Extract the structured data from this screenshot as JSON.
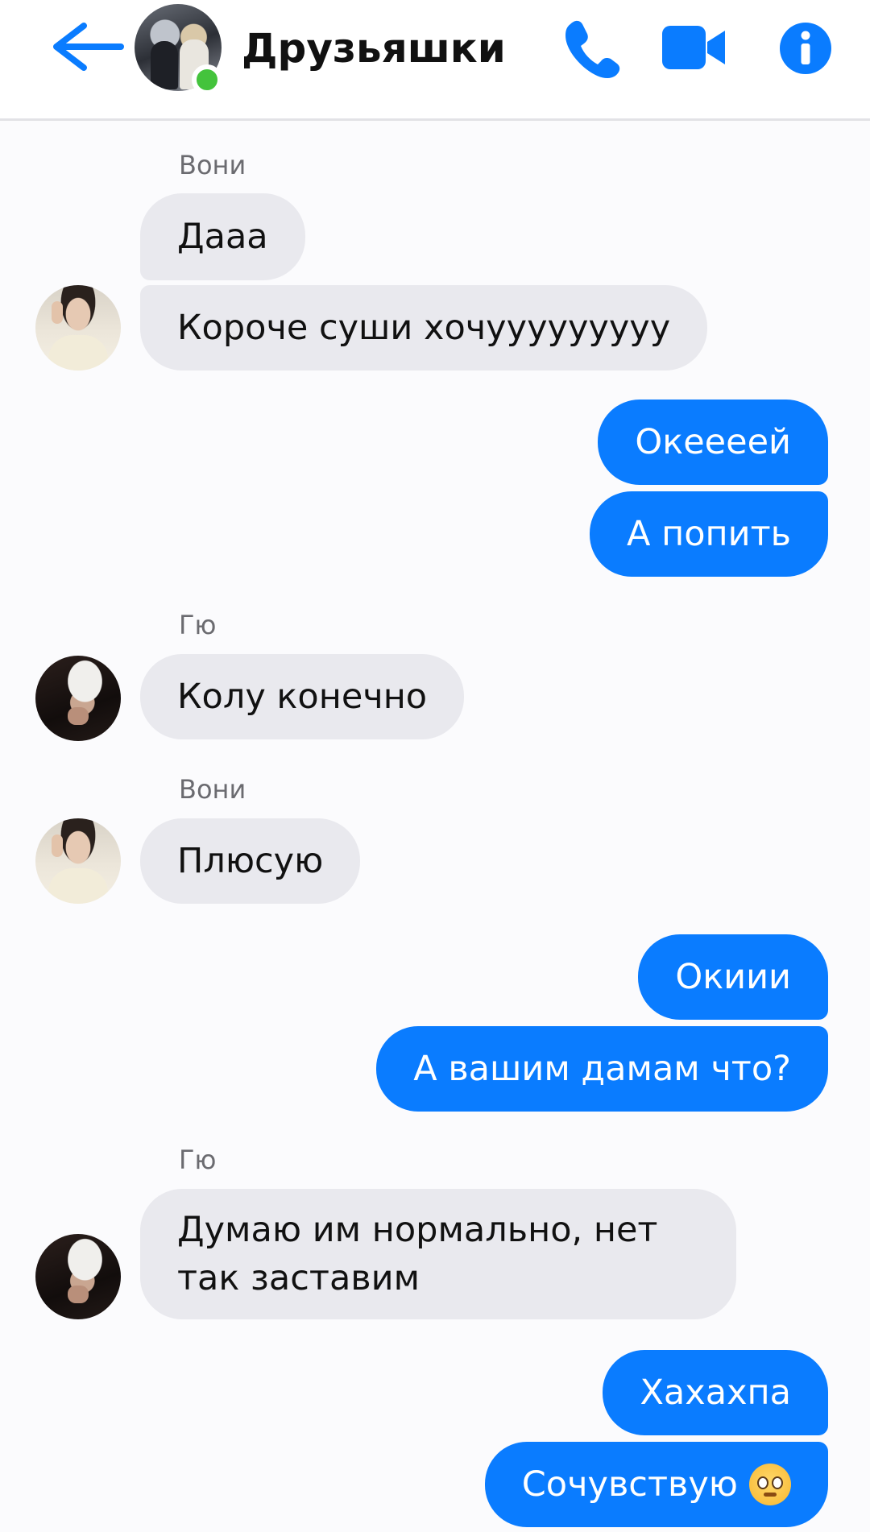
{
  "header": {
    "title": "Друзьяшки",
    "back_icon": "arrow-left-icon",
    "phone_icon": "phone-icon",
    "video_icon": "video-camera-icon",
    "info_icon": "info-icon",
    "accent_color": "#0a7cff",
    "online_status_color": "#44c33c"
  },
  "messages": [
    {
      "sender": "Вони",
      "text": "Дааа",
      "direction": "incoming"
    },
    {
      "sender": "Вони",
      "text": "Короче суши хочууууууууу",
      "direction": "incoming"
    },
    {
      "sender": "me",
      "text": "Океееей",
      "direction": "outgoing"
    },
    {
      "sender": "me",
      "text": "А попить",
      "direction": "outgoing"
    },
    {
      "sender": "Гю",
      "text": "Колу конечно",
      "direction": "incoming"
    },
    {
      "sender": "Вони",
      "text": "Плюсую",
      "direction": "incoming"
    },
    {
      "sender": "me",
      "text": "Окиии",
      "direction": "outgoing"
    },
    {
      "sender": "me",
      "text": "А вашим дамам что?",
      "direction": "outgoing"
    },
    {
      "sender": "Гю",
      "text": "Думаю им нормально, нет так заставим",
      "direction": "incoming"
    },
    {
      "sender": "me",
      "text": "Хахахпа",
      "direction": "outgoing"
    },
    {
      "sender": "me",
      "text": "Сочувствую",
      "emoji": "pleading-face-emoji",
      "direction": "outgoing"
    }
  ],
  "colors": {
    "incoming_bubble": "#e9e9ee",
    "outgoing_bubble": "#0a7cff"
  }
}
